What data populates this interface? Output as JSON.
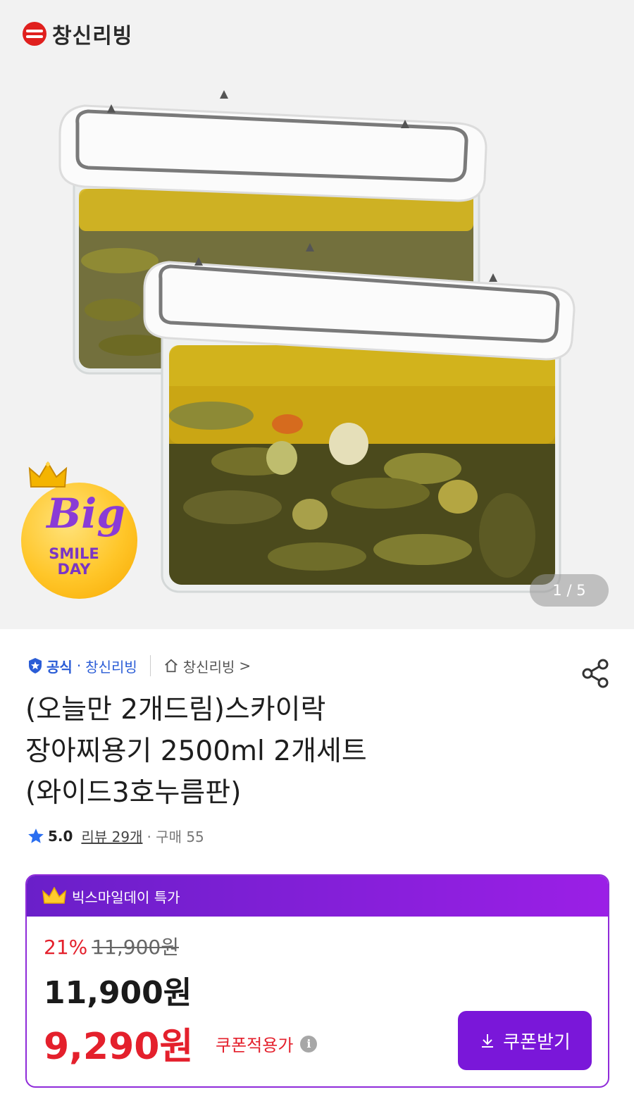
{
  "brand": {
    "name": "창신리빙"
  },
  "hero": {
    "page_indicator": "1 / 5",
    "badge": {
      "big": "Big",
      "smile": "SMILE",
      "day": "DAY"
    }
  },
  "seller": {
    "official_label": "공식",
    "separator": "·",
    "name": "창신리빙",
    "store_link": "창신리빙",
    "chevron": ">"
  },
  "product": {
    "title_lines": [
      "(오늘만 2개드림)스카이락",
      "장아찌용기 2500ml 2개세트",
      "(와이드3호누름판)"
    ]
  },
  "rating": {
    "value": "5.0",
    "review_link": "리뷰 29개",
    "purchase": "· 구매 55"
  },
  "price": {
    "header_label": "빅스마일데이 특가",
    "discount_rate": "21%",
    "original_price": "11,900원",
    "sale_price": "11,900원",
    "coupon_price": "9,290원",
    "coupon_label": "쿠폰적용가",
    "coupon_button": "쿠폰받기",
    "info_glyph": "i"
  },
  "colors": {
    "accent_purple": "#7a17d9",
    "sale_red": "#e4202c",
    "official_blue": "#2a5cd6",
    "brand_red": "#e0201e"
  },
  "icons": [
    "official-shield-icon",
    "home-icon",
    "share-icon",
    "star-icon",
    "crown-icon",
    "info-icon",
    "download-icon"
  ]
}
